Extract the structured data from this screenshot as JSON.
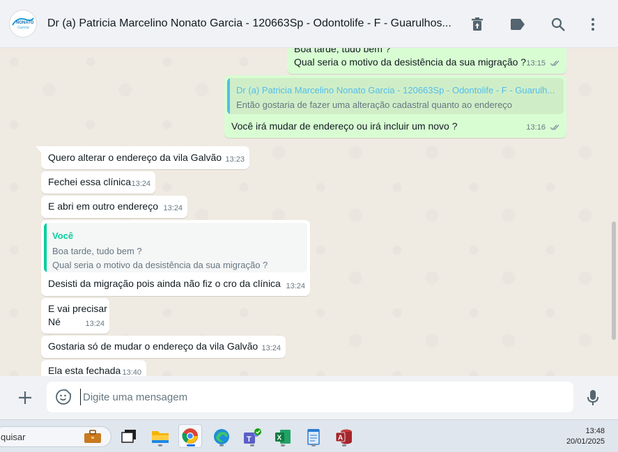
{
  "header": {
    "title": "Dr (a) Patricia Marcelino Nonato Garcia - 120663Sp - Odontolife - F - Guarulhos...",
    "avatar_logo": "NONATO Garcia",
    "icons": [
      "delete-icon",
      "label-icon",
      "search-icon",
      "menu-icon"
    ]
  },
  "messages": {
    "m1": {
      "line1": "Boa tarde, tudo bem ?",
      "line2": "Qual seria o motivo da desistência da sua migração ?",
      "time": "13:15"
    },
    "m2": {
      "quote_author": "Dr (a) Patricia Marcelino Nonato Garcia - 120663Sp - Odontolife - F - Guarulh...",
      "quote_text": "Então gostaria de fazer uma alteração cadastral quanto ao endereço",
      "text": "Você irá mudar de endereço ou irá incluir um novo ?",
      "time": "13:16"
    },
    "m3": {
      "text": "Quero alterar o endereço da vila Galvão",
      "time": "13:23"
    },
    "m4": {
      "text": "Fechei essa clínica",
      "time": "13:24"
    },
    "m5": {
      "text": "E abri em outro endereço",
      "time": "13:24"
    },
    "m6": {
      "quote_author": "Você",
      "quote_line1": "Boa tarde, tudo bem ?",
      "quote_line2": "Qual seria o motivo da desistência da sua migração ?",
      "text": "Desisti da migração pois ainda não fiz o cro da clínica",
      "time": "13:24"
    },
    "m7": {
      "line1": "E vai precisar",
      "line2": "Né",
      "time": "13:24"
    },
    "m8": {
      "text": "Gostaria só de mudar o endereço da vila Galvão",
      "time": "13:24"
    },
    "m9": {
      "text": "Ela esta fechada",
      "time": "13:40"
    }
  },
  "composer": {
    "placeholder": "Digite uma mensagem",
    "value": ""
  },
  "taskbar": {
    "search_text": "quisar",
    "apps": [
      "briefcase-icon",
      "desktop-icon",
      "file-explorer-icon",
      "chrome-icon",
      "edge-icon",
      "teams-icon",
      "excel-icon",
      "notepad-icon",
      "access-icon"
    ],
    "time": "13:48",
    "date": "20/01/2025"
  },
  "colors": {
    "outgoing_bubble": "#d9fdd3",
    "incoming_bubble": "#ffffff",
    "quote_contact": "#53bdeb",
    "quote_self": "#06cf9c",
    "read_ticks": "#8696a0"
  }
}
